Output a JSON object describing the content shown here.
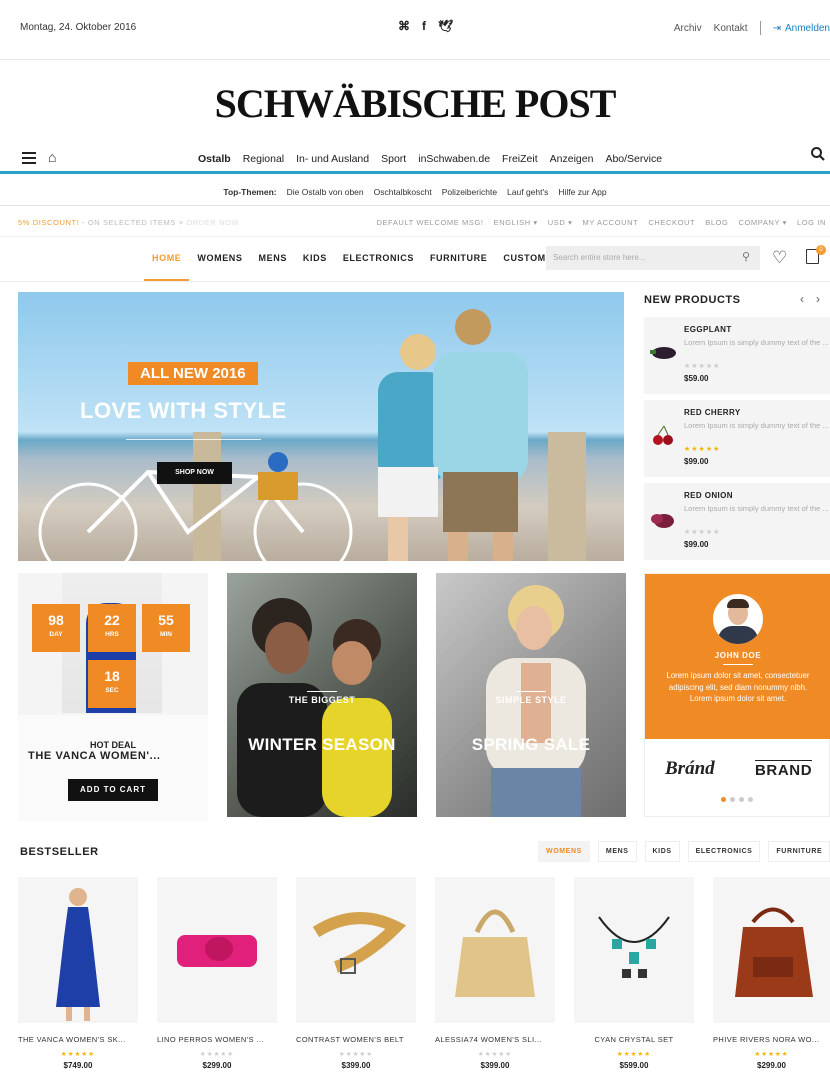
{
  "newspaper": {
    "date": "Montag, 24. Oktober 2016",
    "links": [
      "Archiv",
      "Kontakt"
    ],
    "login": "Anmelden",
    "logo": "SCHWÄBISCHE POST",
    "nav": [
      "Ostalb",
      "Regional",
      "In- und Ausland",
      "Sport",
      "inSchwaben.de",
      "FreiZeit",
      "Anzeigen",
      "Abo/Service"
    ],
    "top_themes_label": "Top-Themen:",
    "top_themes": [
      "Die Ostalb von oben",
      "Oschtalbkoscht",
      "Polizeiberichte",
      "Lauf geht's",
      "Hilfe zur App"
    ]
  },
  "store": {
    "promo_highlight": "5% DISCOUNT!",
    "promo_text": " - ON SELECTED ITEMS >",
    "promo_trail": " ORDER NOW",
    "top_links": [
      "DEFAULT WELCOME MSG!",
      "ENGLISH ▾",
      "USD ▾",
      "MY ACCOUNT",
      "CHECKOUT",
      "BLOG",
      "COMPANY ▾",
      "LOG IN"
    ],
    "menu": [
      "HOME",
      "WOMENS",
      "MENS",
      "KIDS",
      "ELECTRONICS",
      "FURNITURE",
      "CUSTOM"
    ],
    "search_placeholder": "Search entire store here...",
    "cart_count": "0"
  },
  "hero": {
    "tag": "ALL NEW 2016",
    "title": "LOVE WITH STYLE",
    "button": "SHOP NOW"
  },
  "new_products": {
    "title": "NEW PRODUCTS",
    "items": [
      {
        "name": "EGGPLANT",
        "desc": "Lorem Ipsum is simply dummy text of the ...",
        "rating": 0,
        "stars": "★★★★★",
        "price": "$59.00"
      },
      {
        "name": "RED CHERRY",
        "desc": "Lorem Ipsum is simply dummy text of the ...",
        "rating": 5,
        "stars": "★★★★★",
        "price": "$99.00"
      },
      {
        "name": "RED ONION",
        "desc": "Lorem Ipsum is simply dummy text of the ...",
        "rating": 0,
        "stars": "★★★★★",
        "price": "$99.00"
      }
    ]
  },
  "deal": {
    "countdown": [
      {
        "n": "98",
        "u": "DAY"
      },
      {
        "n": "22",
        "u": "HRS"
      },
      {
        "n": "55",
        "u": "MIN"
      },
      {
        "n": "18",
        "u": "SEC"
      }
    ],
    "hot": "HOT DEAL",
    "name": "THE VANCA WOMEN'...",
    "button": "ADD TO CART"
  },
  "banners": [
    {
      "sub": "THE BIGGEST",
      "title": "WINTER SEASON"
    },
    {
      "sub": "SIMPLE STYLE",
      "title": "SPRING SALE"
    }
  ],
  "testimonial": {
    "name": "JOHN DOE",
    "text": "Lorem ipsum dolor sit amet, consectetuer adipiscing elit, sed diam nonummy nibh. Lorem ipsum dolor sit amet.",
    "brand1": "Bránd",
    "brand2": "BRAND"
  },
  "bestseller": {
    "title": "BESTSELLER",
    "tabs": [
      "WOMENS",
      "MENS",
      "KIDS",
      "ELECTRONICS",
      "FURNITURE"
    ],
    "products": [
      {
        "name": "THE VANCA WOMEN'S SK...",
        "rating": 5,
        "stars": "★★★★★",
        "price": "$749.00"
      },
      {
        "name": "LINO PERROS WOMEN'S ...",
        "rating": 0,
        "stars": "★★★★★",
        "price": "$299.00"
      },
      {
        "name": "CONTRAST WOMEN'S BELT",
        "rating": 0,
        "stars": "★★★★★",
        "price": "$399.00"
      },
      {
        "name": "ALESSIA74 WOMEN'S SLI...",
        "rating": 0,
        "stars": "★★★★★",
        "price": "$399.00"
      },
      {
        "name": "CYAN CRYSTAL SET",
        "rating": 5,
        "stars": "★★★★★",
        "price": "$599.00"
      },
      {
        "name": "PHIVE RIVERS NORA WO...",
        "rating": 5,
        "stars": "★★★★★",
        "price": "$299.00"
      }
    ]
  },
  "colors": {
    "accent": "#f08a24",
    "nav_rule": "#2aa0c8",
    "link": "#1a7fc1"
  }
}
